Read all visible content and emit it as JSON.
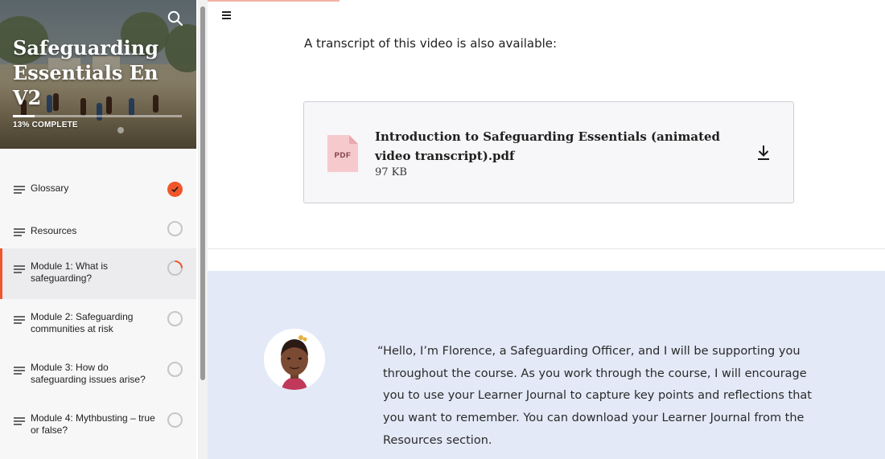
{
  "course": {
    "title": "Safeguarding Essentials En V2",
    "progress_label": "13% COMPLETE",
    "progress_fraction": 0.13
  },
  "icons": {
    "search": "search-icon",
    "menu": "menu-icon",
    "lesson": "lesson-lines-icon",
    "complete": "check-circle-icon",
    "incomplete": "empty-circle-icon",
    "in_progress": "partial-circle-icon",
    "file": "pdf-file-icon",
    "download": "download-icon"
  },
  "colors": {
    "accent": "#f0562a",
    "quote_background": "#e3e9f7",
    "card_background": "#f7f6f8"
  },
  "sidebar": {
    "items": [
      {
        "label": "Glossary",
        "status": "complete"
      },
      {
        "label": "Resources",
        "status": "incomplete"
      },
      {
        "label": "Module 1: What is safeguarding?",
        "status": "in_progress",
        "active": true
      },
      {
        "label": "Module 2: Safeguarding communities at risk",
        "status": "incomplete"
      },
      {
        "label": "Module 3: How do safeguarding issues arise?",
        "status": "incomplete"
      },
      {
        "label": "Module 4: Mythbusting – true or false?",
        "status": "incomplete"
      }
    ]
  },
  "main": {
    "transcript_intro": "A transcript of this video is also available:",
    "attachment": {
      "badge": "PDF",
      "file_name": "Introduction to Safeguarding Essentials (animated video transcript).pdf",
      "file_size": "97 KB"
    },
    "quote": {
      "text": "“Hello, I’m Florence, a Safeguarding Officer, and I will be supporting you throughout the course. As you work through the course, I will encourage you to use your Learner Journal to capture key points and reflections that you want to remember. You can download your Learner Journal from the Resources section."
    }
  }
}
